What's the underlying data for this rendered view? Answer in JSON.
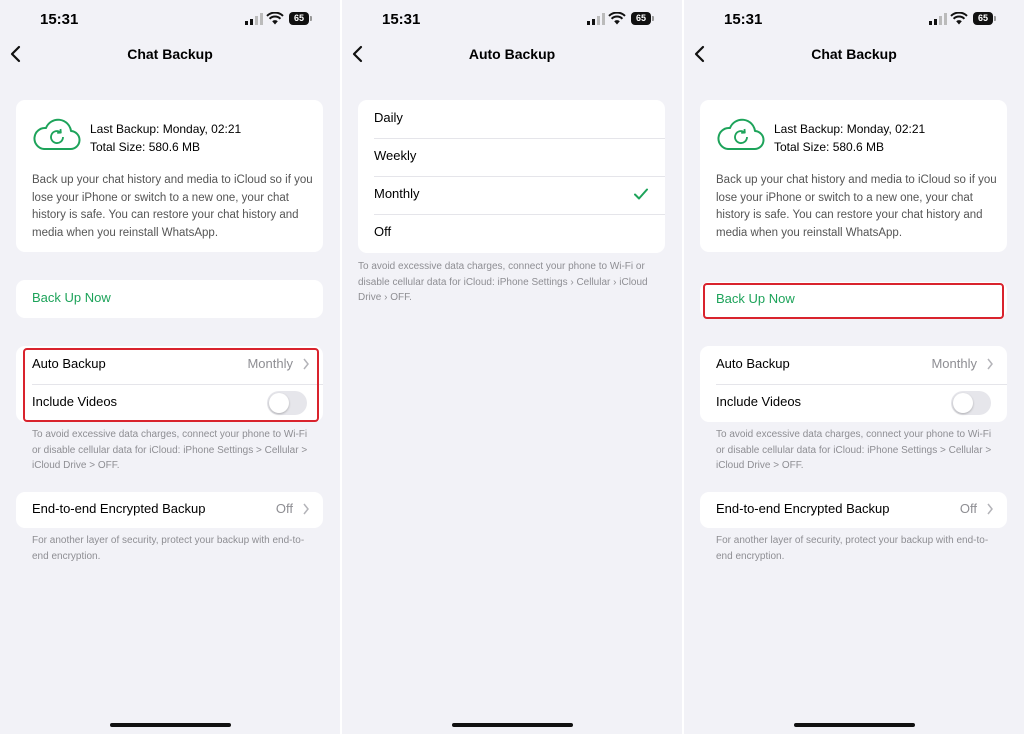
{
  "status_bar": {
    "time": "15:31",
    "battery": "65"
  },
  "screens": [
    {
      "title": "Chat Backup",
      "last_backup": "Last Backup: Monday, 02:21",
      "total_size": "Total Size: 580.6 MB",
      "description": "Back up your chat history and media to iCloud so if you lose your iPhone or switch to a new one, your chat history is safe. You can restore your chat history and media when you reinstall WhatsApp.",
      "back_up_now": "Back Up Now",
      "auto_backup_label": "Auto Backup",
      "auto_backup_value": "Monthly",
      "include_videos_label": "Include Videos",
      "include_videos_on": false,
      "data_note": "To avoid excessive data charges, connect your phone to Wi-Fi or disable cellular data for iCloud: iPhone Settings > Cellular > iCloud Drive > OFF.",
      "e2e_label": "End-to-end Encrypted Backup",
      "e2e_value": "Off",
      "e2e_note": "For another layer of security, protect your backup with end-to-end encryption.",
      "highlighted": "auto-backup-group"
    },
    {
      "title": "Auto Backup",
      "options": [
        "Daily",
        "Weekly",
        "Monthly",
        "Off"
      ],
      "selected": "Monthly",
      "note": "To avoid excessive data charges, connect your phone to Wi-Fi or disable cellular data for iCloud: iPhone Settings › Cellular › iCloud Drive › OFF."
    },
    {
      "title": "Chat Backup",
      "last_backup": "Last Backup: Monday, 02:21",
      "total_size": "Total Size: 580.6 MB",
      "description": "Back up your chat history and media to iCloud so if you lose your iPhone or switch to a new one, your chat history is safe. You can restore your chat history and media when you reinstall WhatsApp.",
      "back_up_now": "Back Up Now",
      "auto_backup_label": "Auto Backup",
      "auto_backup_value": "Monthly",
      "include_videos_label": "Include Videos",
      "include_videos_on": false,
      "data_note": "To avoid excessive data charges, connect your phone to Wi-Fi or disable cellular data for iCloud: iPhone Settings > Cellular > iCloud Drive > OFF.",
      "e2e_label": "End-to-end Encrypted Backup",
      "e2e_value": "Off",
      "e2e_note": "For another layer of security, protect your backup with end-to-end encryption.",
      "highlighted": "back-up-now-button"
    }
  ],
  "colors": {
    "accent_green": "#1da35a",
    "highlight_red": "#d9232d",
    "background": "#f2f2f7"
  }
}
